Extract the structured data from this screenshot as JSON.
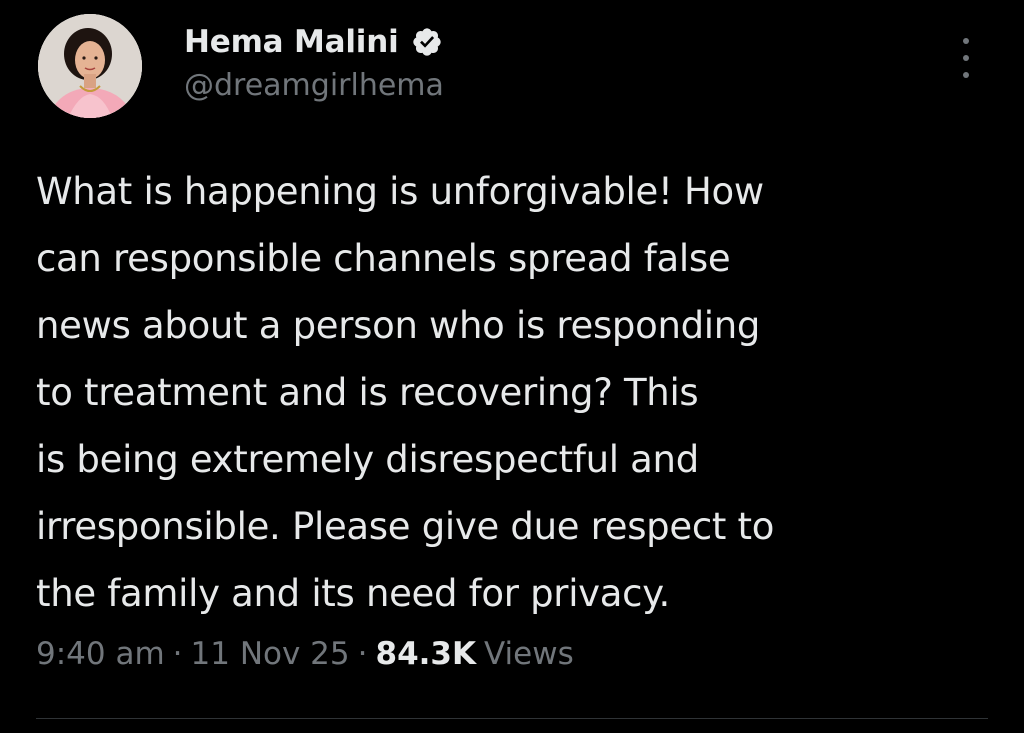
{
  "tweet": {
    "author": {
      "display_name": "Hema Malini",
      "handle": "@dreamgirlhema",
      "verified": true,
      "avatar_icon": "profile-photo"
    },
    "text": "What is happening is unforgivable! How\ncan responsible channels spread false\nnews about a person who is responding\nto treatment and is recovering? This\nis being extremely disrespectful and\nirresponsible. Please give due respect to\nthe family and its need for privacy.",
    "time": "9:40 am",
    "date": "11 Nov 25",
    "separator": "·",
    "views_count": "84.3K",
    "views_label": "Views",
    "more_icon": "more-options-icon"
  },
  "colors": {
    "background": "#000000",
    "primary_text": "#e7e9ea",
    "secondary_text": "#71767b",
    "verified_badge": "#1d9bf0",
    "divider": "#2f3336"
  }
}
